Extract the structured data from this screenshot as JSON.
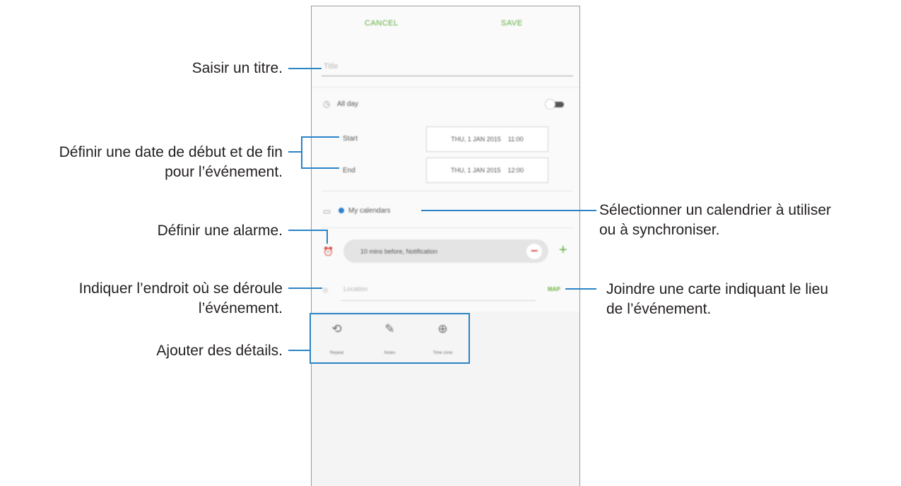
{
  "phone": {
    "top_bar": {
      "cancel": "CANCEL",
      "save": "SAVE"
    },
    "title_placeholder": "Title",
    "all_day": {
      "label": "All day",
      "icon": "clock-icon",
      "toggle_on": false
    },
    "start": {
      "label": "Start",
      "date": "THU, 1 JAN 2015",
      "time": "11:00"
    },
    "end": {
      "label": "End",
      "date": "THU, 1 JAN 2015",
      "time": "12:00"
    },
    "calendar": {
      "icon": "calendar-icon",
      "name": "My calendars",
      "dot_color": "#2c7fd0"
    },
    "alarm": {
      "icon": "alarm-icon",
      "value": "10 mins before, Notification"
    },
    "location": {
      "icon": "location-pin-icon",
      "placeholder": "Location",
      "map_label": "MAP"
    },
    "details": [
      {
        "icon": "repeat-icon",
        "label": "Repeat"
      },
      {
        "icon": "notes-icon",
        "label": "Notes"
      },
      {
        "icon": "time-zone-icon",
        "label": "Time zone"
      }
    ],
    "accent_color": "#5fae3c"
  },
  "annotations": {
    "title": "Saisir un titre.",
    "dates_1": "Définir une date de début et de fin",
    "dates_2": "pour l’événement.",
    "alarm": "Définir une alarme.",
    "location_1": "Indiquer l’endroit où se déroule",
    "location_2": "l’événement.",
    "details": "Ajouter des détails.",
    "calendar_1": "Sélectionner un calendrier à utiliser",
    "calendar_2": "ou à synchroniser.",
    "map_1": "Joindre une carte indiquant le lieu",
    "map_2": "de l’événement.",
    "line_color": "#2a84c6"
  }
}
